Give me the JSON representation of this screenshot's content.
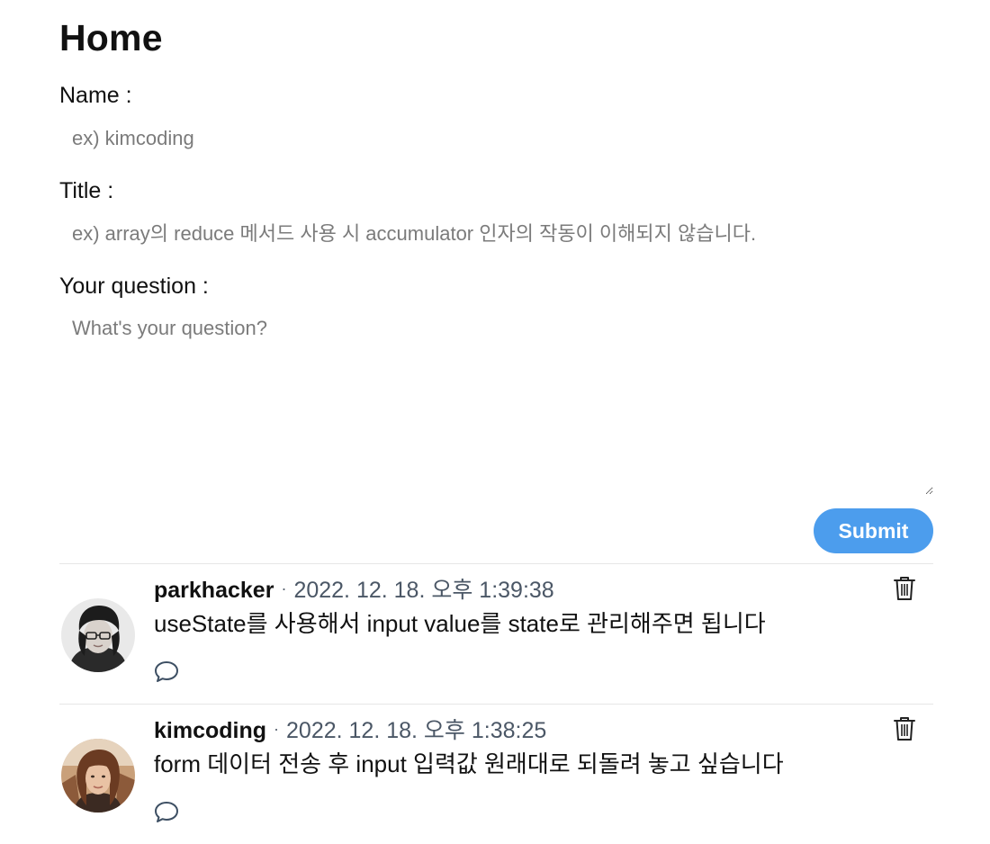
{
  "page": {
    "title": "Home"
  },
  "form": {
    "name_label": "Name :",
    "name_placeholder": "ex) kimcoding",
    "name_value": "",
    "title_label": "Title :",
    "title_placeholder": "ex) array의 reduce 메서드 사용 시 accumulator 인자의 작동이 이해되지 않습니다.",
    "title_value": "",
    "question_label": "Your question :",
    "question_placeholder": "What's your question?",
    "question_value": "",
    "submit_label": "Submit"
  },
  "discussions": [
    {
      "author": "parkhacker",
      "separator": "·",
      "created_at": "2022. 12. 18. 오후 1:39:38",
      "content": "useState를 사용해서 input value를 state로 관리해주면 됩니다",
      "comment_icon": "speech-bubble-icon",
      "delete_icon": "trash-icon"
    },
    {
      "author": "kimcoding",
      "separator": "·",
      "created_at": "2022. 12. 18. 오후 1:38:25",
      "content": "form 데이터 전송 후 input 입력값 원래대로 되돌려 놓고 싶습니다",
      "comment_icon": "speech-bubble-icon",
      "delete_icon": "trash-icon"
    }
  ],
  "colors": {
    "accent": "#4c9ded",
    "timestamp": "#4b5766",
    "placeholder": "#7b7b7b",
    "divider": "#e6e6e6"
  }
}
